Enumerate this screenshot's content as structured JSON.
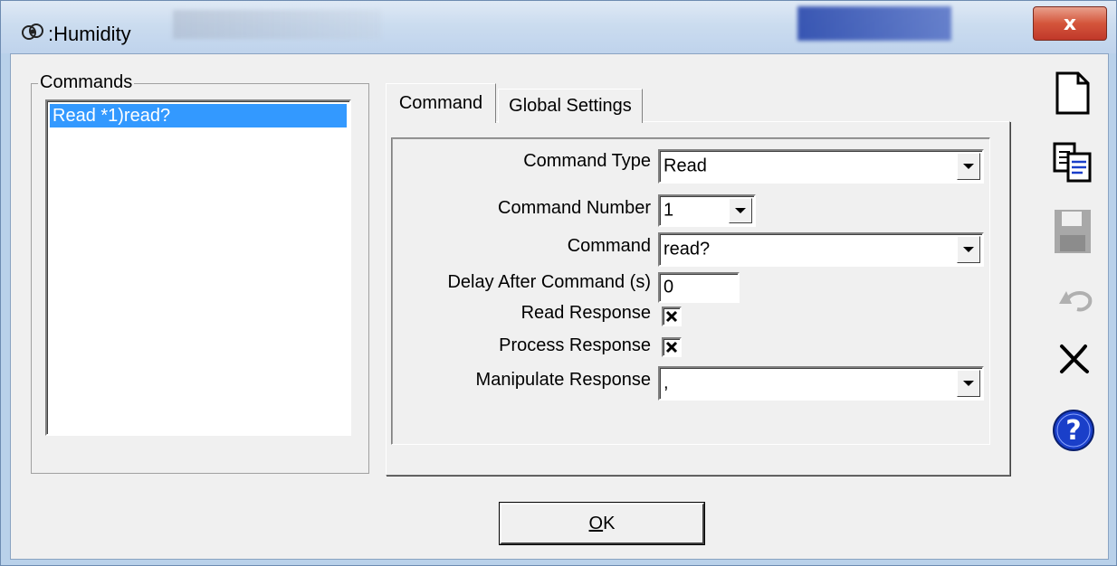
{
  "window": {
    "title": ":Humidity",
    "close_label": "x"
  },
  "commands_group": {
    "label": "Commands",
    "items": [
      {
        "label": "Read *1)read?",
        "selected": true
      }
    ]
  },
  "tabs": [
    {
      "label": "Command",
      "active": true
    },
    {
      "label": "Global Settings",
      "active": false
    }
  ],
  "form": {
    "command_type": {
      "label": "Command Type",
      "value": "Read"
    },
    "command_number": {
      "label": "Command Number",
      "value": "1"
    },
    "command": {
      "label": "Command",
      "value": "read?"
    },
    "delay": {
      "label": "Delay After Command (s)",
      "value": "0"
    },
    "read_response": {
      "label": "Read Response",
      "checked": true
    },
    "process_response": {
      "label": "Process Response",
      "checked": true
    },
    "manipulate_response": {
      "label": "Manipulate Response",
      "value": ","
    }
  },
  "toolbar_icons": [
    "new-document-icon",
    "copy-icon",
    "save-icon",
    "undo-icon",
    "delete-icon",
    "help-icon"
  ],
  "ok_button": {
    "mnemonic": "O",
    "rest": "K"
  },
  "colors": {
    "selection": "#3399ff",
    "help_blue": "#1a3fc9",
    "close_red": "#c0382a"
  }
}
